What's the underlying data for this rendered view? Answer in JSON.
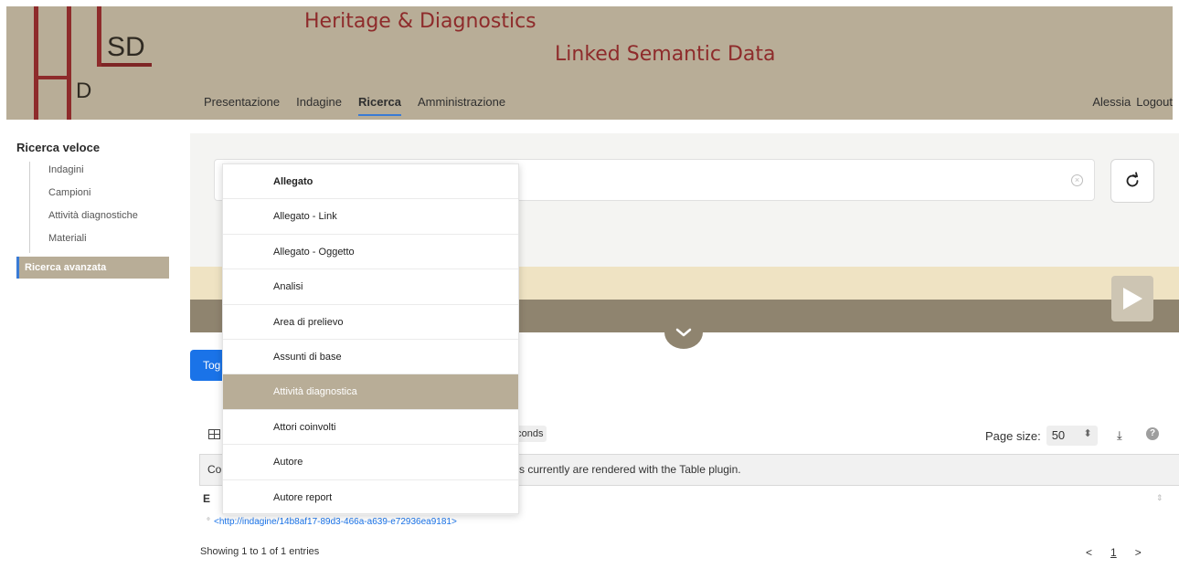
{
  "header": {
    "title_line1": "Heritage & Diagnostics",
    "title_line2": "Linked Semantic Data",
    "logo": {
      "letters_top": "SD",
      "letters_bottom": "D",
      "letter_big": "H",
      "letter_l": "L",
      "color": "#8e2b2b"
    },
    "nav": [
      "Presentazione",
      "Indagine",
      "Ricerca",
      "Amministrazione"
    ],
    "nav_active": "Ricerca",
    "user": "Alessia",
    "logout": "Logout"
  },
  "sidebar": {
    "heading": "Ricerca veloce",
    "items": [
      "Indagini",
      "Campioni",
      "Attività diagnostiche",
      "Materiali"
    ],
    "advanced": "Ricerca avanzata"
  },
  "search": {
    "clear_icon": "clear-circle-icon",
    "refresh_icon": "refresh-icon"
  },
  "toggle_label": "Tog",
  "results": {
    "time_badge": "econds",
    "page_size_label": "Page size:",
    "page_size_value": "50",
    "notice_start": "Co",
    "notice_tail": "s currently are rendered with the Table plugin.",
    "column_head": "E",
    "row_link": "<http://indagine/14b8af17-89d3-466a-a639-e72936ea9181>",
    "entries": "Showing 1 to 1 of 1 entries",
    "pager_prev": "<",
    "pager_page": "1",
    "pager_next": ">"
  },
  "dropdown": {
    "options": [
      "Allegato",
      "Allegato - Link",
      "Allegato - Oggetto",
      "Analisi",
      "Area di prelievo",
      "Assunti di base",
      "Attività diagnostica",
      "Attori coinvolti",
      "Autore",
      "Autore report"
    ],
    "bold_index": 0,
    "selected_index": 6
  },
  "colors": {
    "header_bg": "#b8ad97",
    "title": "#8e2b2b",
    "accent": "#1a73e8",
    "yasqe_strip": "#efe3c3",
    "yasr_strip": "#8f846f"
  }
}
